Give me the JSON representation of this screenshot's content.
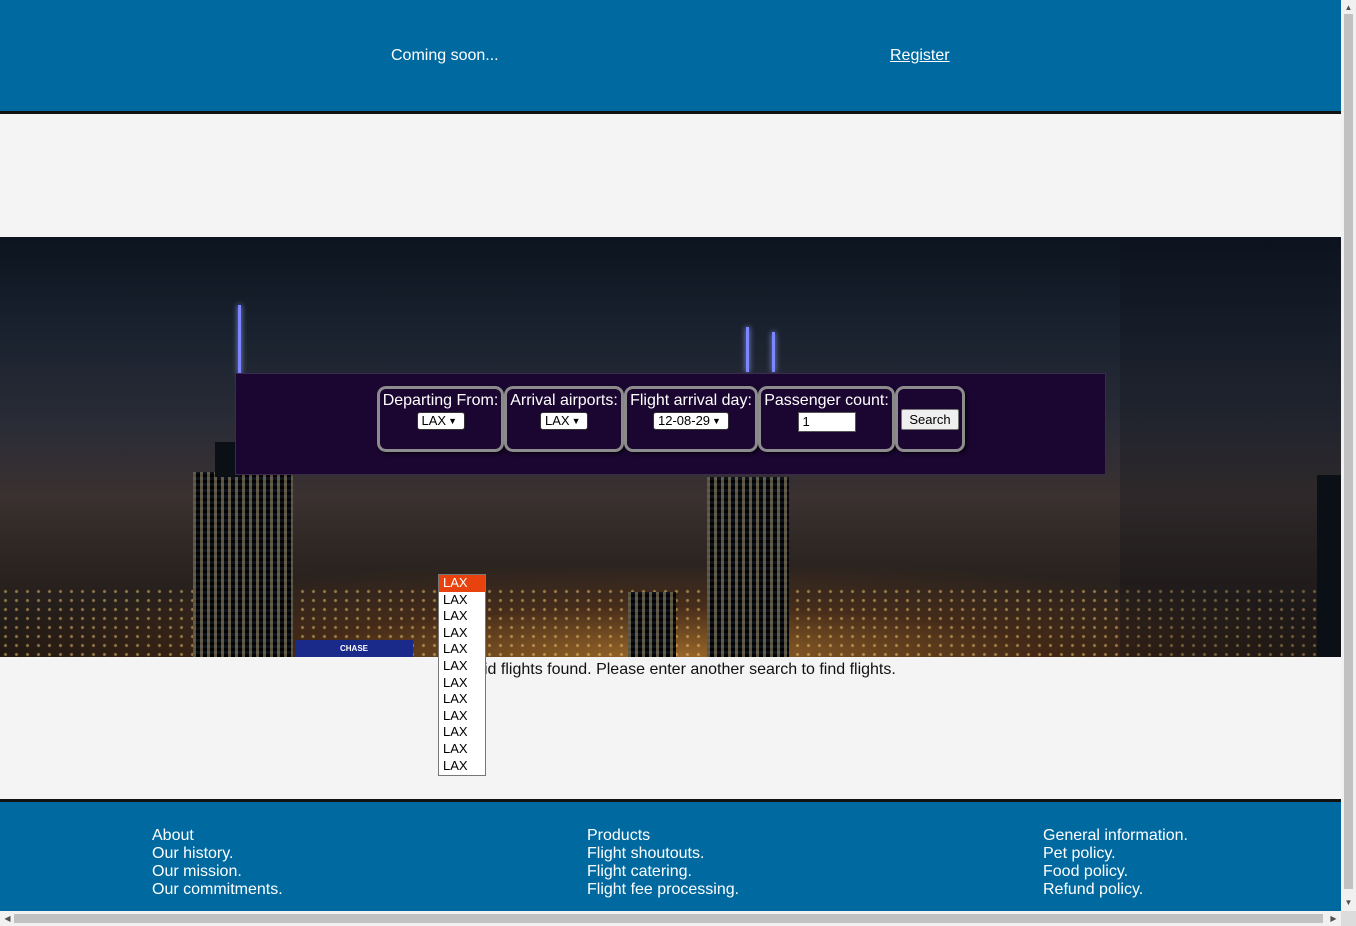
{
  "header": {
    "coming_soon": "Coming soon...",
    "register_link": "Register"
  },
  "search": {
    "departing_label": "Departing From:",
    "departing_value": "LAX",
    "arrival_label": "Arrival airports:",
    "arrival_value": "LAX",
    "day_label": "Flight arrival day:",
    "day_value": "12-08-29",
    "passenger_label": "Passenger count:",
    "passenger_value": "1",
    "search_button": "Search"
  },
  "hero": {
    "sign_text": "CHASE"
  },
  "message": "id flights found. Please enter another search to find flights.",
  "dropdown": {
    "options": [
      "LAX",
      "LAX",
      "LAX",
      "LAX",
      "LAX",
      "LAX",
      "LAX",
      "LAX",
      "LAX",
      "LAX",
      "LAX",
      "LAX"
    ],
    "selected_index": 0
  },
  "footer": {
    "about": {
      "heading": "About",
      "links": [
        "Our history.",
        "Our mission.",
        "Our commitments."
      ]
    },
    "products": {
      "heading": "Products",
      "links": [
        "Flight shoutouts.",
        "Flight catering.",
        "Flight fee processing."
      ]
    },
    "general": {
      "heading": "General information.",
      "links": [
        "Pet policy.",
        "Food policy.",
        "Refund policy."
      ]
    }
  },
  "colors": {
    "header_bg": "#006aa0",
    "panel_bg": "#1a0631",
    "selected_option": "#e8430f"
  },
  "icons": {
    "select_arrow": "chevron-down-icon",
    "scroll_up": "arrow-up-icon",
    "scroll_down": "arrow-down-icon",
    "scroll_left": "arrow-left-icon",
    "scroll_right": "arrow-right-icon"
  }
}
